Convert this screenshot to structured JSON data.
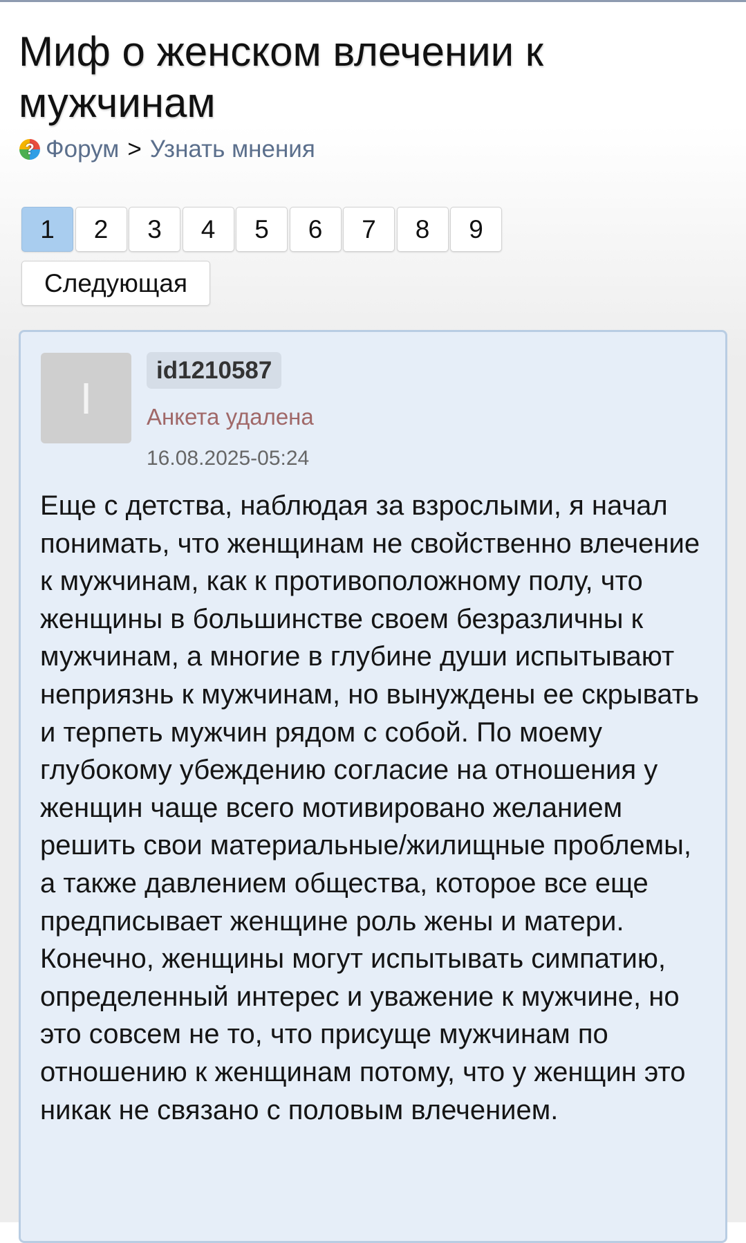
{
  "title": "Миф о женском влечении к мужчинам",
  "breadcrumb": {
    "forum": "Форум",
    "separator": ">",
    "section": "Узнать мнения"
  },
  "pagination": {
    "pages": [
      "1",
      "2",
      "3",
      "4",
      "5",
      "6",
      "7",
      "8",
      "9"
    ],
    "current": "1",
    "next_label": "Следующая"
  },
  "post": {
    "avatar_letter": "I",
    "username": "id1210587",
    "status": "Анкета удалена",
    "date": "16.08.2025-05:24",
    "text": "Еще с детства, наблюдая за взрослыми, я начал понимать, что женщинам не свойственно влечение к мужчинам, как к противоположному полу, что женщины в большинстве своем безразличны к мужчинам, а многие в глубине души испытывают неприязнь к мужчинам, но вынуждены ее скрывать и терпеть мужчин рядом с собой. По моему глубокому убеждению согласие на отношения у женщин чаще всего мотивировано желанием решить свои материальные/жилищные проблемы, а также давлением общества, которое все еще предписывает женщине роль жены и матери. Конечно, женщины могут испытывать симпатию, определенный интерес и уважение к мужчине, но это совсем не то, что присуще мужчинам по отношению к женщинам потому, что у женщин это никак не связано с половым влечением."
  },
  "colors": {
    "active_page": "#a9cdef",
    "card_background": "#e6eef8",
    "card_border": "#b9cde3",
    "link": "#5b6f8c",
    "status": "#a06868"
  },
  "icons": {
    "forum": "question-circle-icon"
  }
}
